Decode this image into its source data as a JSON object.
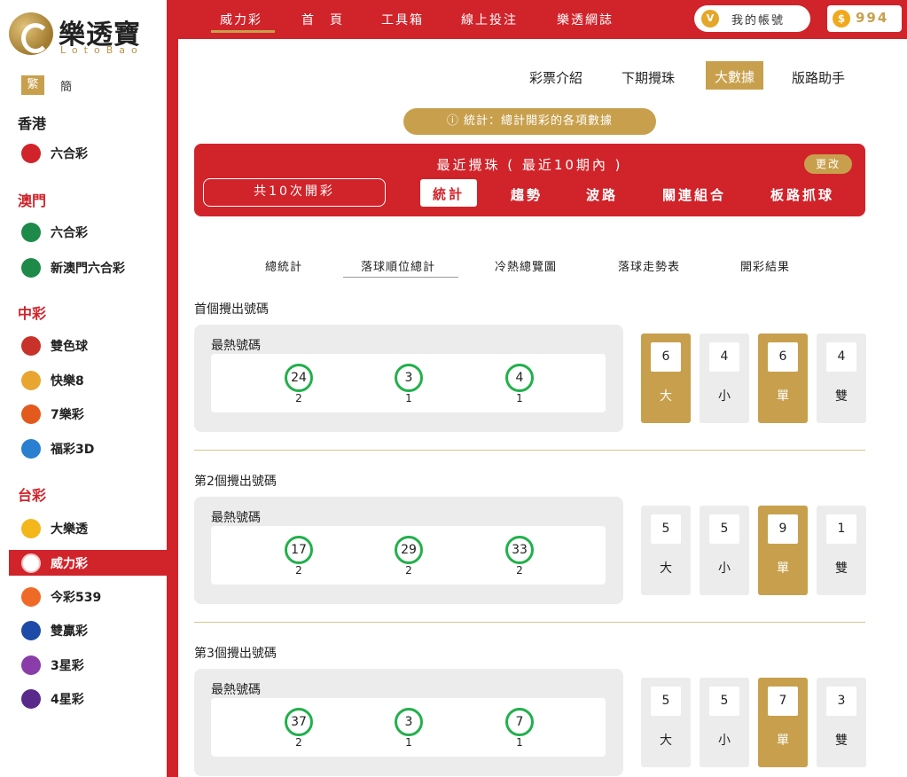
{
  "logo": {
    "text": "樂透寶",
    "sub": "LotoBao"
  },
  "lang": {
    "active": "繁",
    "other": "簡"
  },
  "sidebar": {
    "regions": [
      {
        "label": "香港",
        "games": [
          {
            "label": "六合彩",
            "color": "#d1232a"
          }
        ]
      },
      {
        "label": "澳門",
        "games": [
          {
            "label": "六合彩",
            "color": "#1e8a4a"
          },
          {
            "label": "新澳門六合彩",
            "color": "#1e8a4a"
          }
        ]
      },
      {
        "label": "中彩",
        "games": [
          {
            "label": "雙色球",
            "color": "#c8322b"
          },
          {
            "label": "快樂8",
            "color": "#e8a631"
          },
          {
            "label": "7樂彩",
            "color": "#e25a1c"
          },
          {
            "label": "福彩3D",
            "color": "#2a7fd1"
          }
        ]
      },
      {
        "label": "台彩",
        "games": [
          {
            "label": "大樂透",
            "color": "#f3b71c"
          },
          {
            "label": "威力彩",
            "color": "#d1232a"
          },
          {
            "label": "今彩539",
            "color": "#f06a27"
          },
          {
            "label": "雙贏彩",
            "color": "#1e4aa8"
          },
          {
            "label": "3星彩",
            "color": "#8a3da8"
          },
          {
            "label": "4星彩",
            "color": "#5a2a8a"
          }
        ]
      }
    ]
  },
  "topnav": {
    "items": [
      "威力彩",
      "首　頁",
      "工具箱",
      "線上投注",
      "樂透網誌"
    ],
    "account": "我的帳號",
    "coins": "994"
  },
  "subtabs": [
    "彩票介紹",
    "下期攪珠",
    "大數據",
    "版路助手"
  ],
  "info_pill": "ⓘ 統計：總計開彩的各項數據",
  "panel": {
    "title": "最近攪珠 ( 最近10期內 )",
    "change": "更改",
    "count": "共10次開彩",
    "tabs": [
      "統計",
      "趨勢",
      "波路",
      "關連組合",
      "板路抓球"
    ]
  },
  "lower_tabs": [
    "總統計",
    "落球順位總計",
    "冷熱總覽圖",
    "落球走勢表",
    "開彩結果"
  ],
  "sections": [
    {
      "title": "首個攪出號碼",
      "hot_label": "最熱號碼",
      "balls": [
        {
          "num": "24",
          "count": "2"
        },
        {
          "num": "3",
          "count": "1"
        },
        {
          "num": "4",
          "count": "1"
        }
      ],
      "stats": [
        {
          "value": "6",
          "label": "大"
        },
        {
          "value": "4",
          "label": "小"
        },
        {
          "value": "6",
          "label": "單"
        },
        {
          "value": "4",
          "label": "雙"
        }
      ]
    },
    {
      "title": "第2個攪出號碼",
      "hot_label": "最熱號碼",
      "balls": [
        {
          "num": "17",
          "count": "2"
        },
        {
          "num": "29",
          "count": "2"
        },
        {
          "num": "33",
          "count": "2"
        }
      ],
      "stats": [
        {
          "value": "5",
          "label": "大"
        },
        {
          "value": "5",
          "label": "小"
        },
        {
          "value": "9",
          "label": "單"
        },
        {
          "value": "1",
          "label": "雙"
        }
      ]
    },
    {
      "title": "第3個攪出號碼",
      "hot_label": "最熱號碼",
      "balls": [
        {
          "num": "37",
          "count": "2"
        },
        {
          "num": "3",
          "count": "1"
        },
        {
          "num": "7",
          "count": "1"
        }
      ],
      "stats": [
        {
          "value": "5",
          "label": "大"
        },
        {
          "value": "5",
          "label": "小"
        },
        {
          "value": "7",
          "label": "單"
        },
        {
          "value": "3",
          "label": "雙"
        }
      ]
    }
  ]
}
